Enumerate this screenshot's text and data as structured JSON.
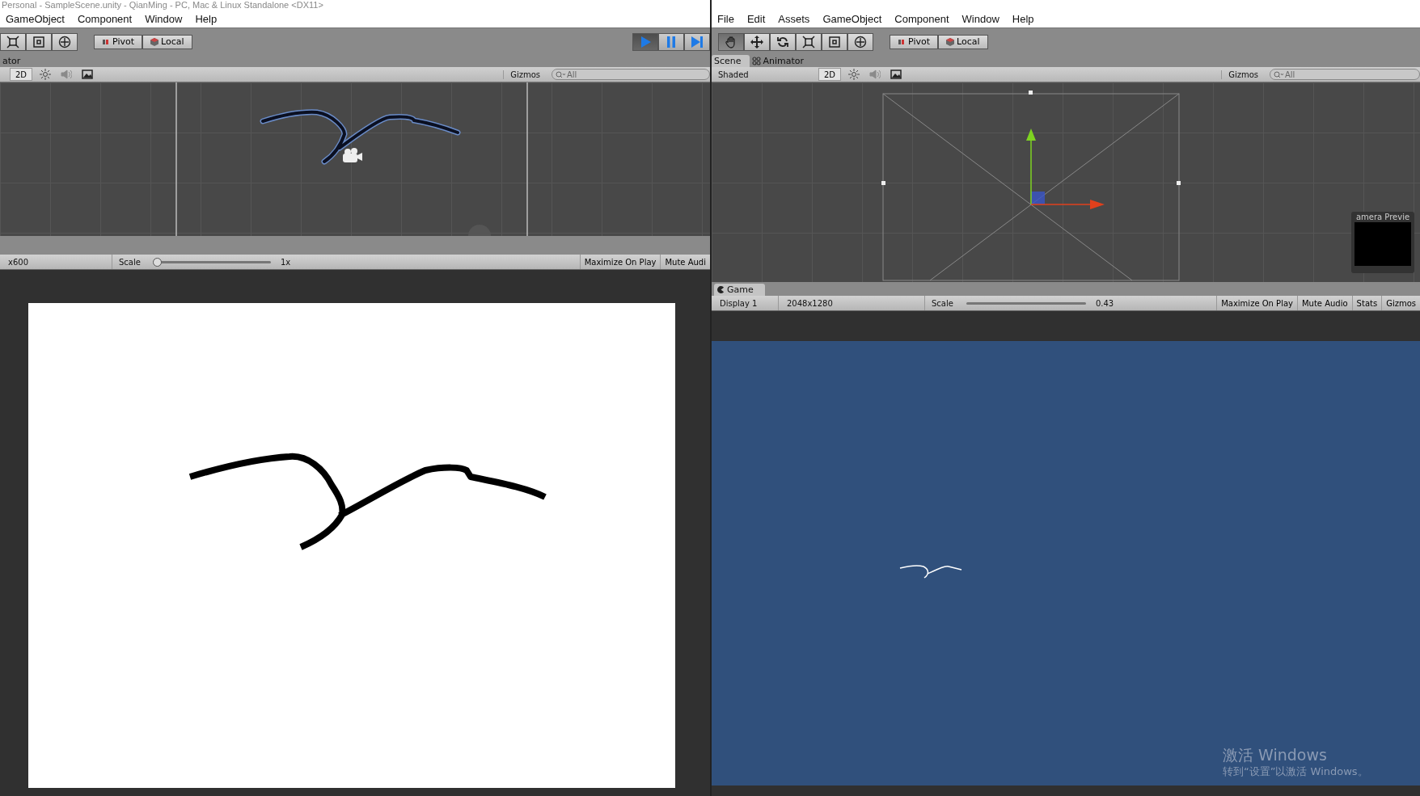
{
  "windows": [
    {
      "title": "Personal - SampleScene.unity - QianMing - PC, Mac & Linux Standalone <DX11>",
      "menu": [
        "GameObject",
        "Component",
        "Window",
        "Help"
      ],
      "tools": [
        {
          "kind": "scale",
          "selected": false
        },
        {
          "kind": "rect",
          "selected": false
        },
        {
          "kind": "transform",
          "selected": false
        }
      ],
      "pivot": "Pivot",
      "local": "Local",
      "play_controls": [
        {
          "kind": "play",
          "selected": true
        },
        {
          "kind": "pause",
          "selected": false
        },
        {
          "kind": "step",
          "selected": false
        }
      ],
      "tabs": [
        {
          "label": "ator",
          "selected": false
        }
      ],
      "scene_toolbar": {
        "mode": "2D",
        "gizmos": "Gizmos",
        "search": "All"
      },
      "scene": {
        "kind": "bird"
      },
      "game_toolbar": {
        "resolution": "x600",
        "scale_label": "Scale",
        "scale": "1x",
        "level": 0,
        "buttons": [
          "Maximize On Play",
          "Mute Audi"
        ]
      },
      "game": {
        "kind": "canvas"
      }
    },
    {
      "menu": [
        "File",
        "Edit",
        "Assets",
        "GameObject",
        "Component",
        "Window",
        "Help"
      ],
      "tools": [
        {
          "kind": "hand",
          "selected": true
        },
        {
          "kind": "move",
          "selected": false
        },
        {
          "kind": "rotate",
          "selected": false
        },
        {
          "kind": "scale",
          "selected": false
        },
        {
          "kind": "rect",
          "selected": false
        },
        {
          "kind": "transform",
          "selected": false
        }
      ],
      "pivot": "Pivot",
      "local": "Local",
      "tabs": [
        {
          "label": "Scene",
          "selected": true
        },
        {
          "label": "Animator",
          "selected": false
        }
      ],
      "scene_toolbar": {
        "shading": "Shaded",
        "mode": "2D",
        "gizmos": "Gizmos",
        "search": "All"
      },
      "scene": {
        "kind": "camera",
        "preview_title": "amera Previe"
      },
      "game_tab": "Game",
      "game_toolbar": {
        "display": "Display 1",
        "resolution": "2048x1280",
        "scale_label": "Scale",
        "scale": "0.43",
        "buttons": [
          "Maximize On Play",
          "Mute Audio",
          "Stats",
          "Gizmos"
        ]
      },
      "game": {
        "kind": "blue"
      }
    }
  ],
  "activation": {
    "title": "激活 Windows",
    "subtitle": "转到“设置”以激活 Windows。"
  }
}
